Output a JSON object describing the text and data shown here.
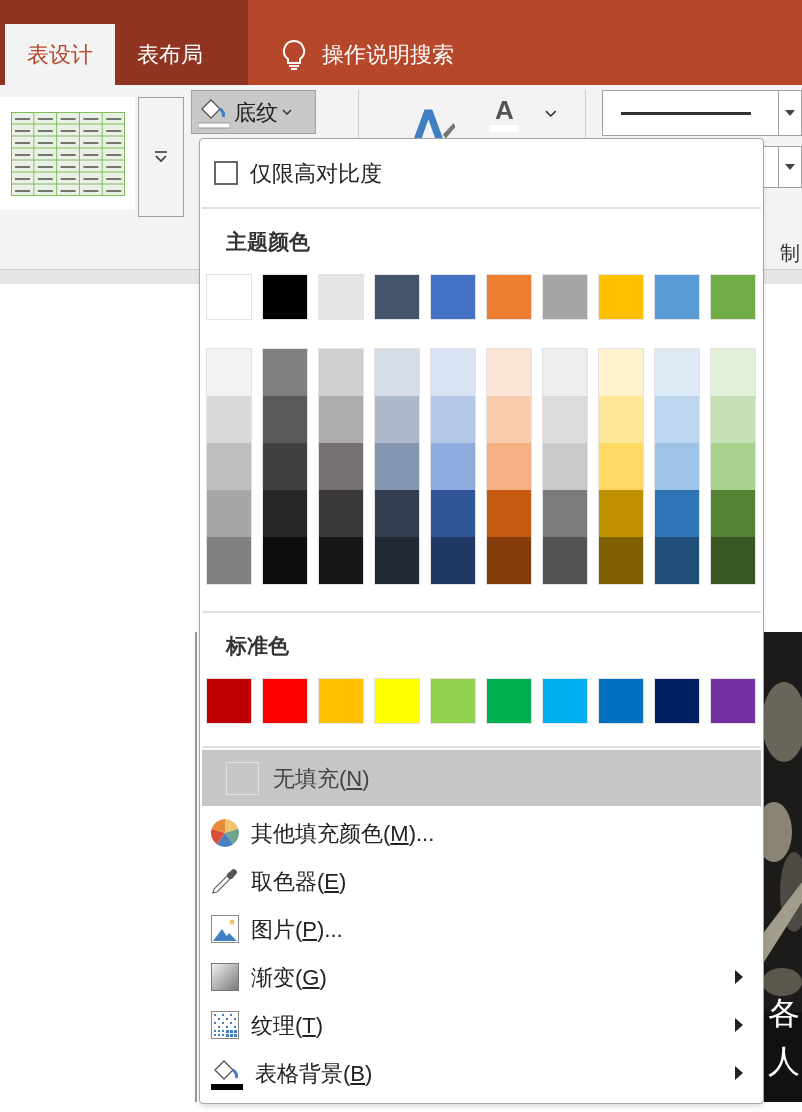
{
  "ribbon_tabs": [
    {
      "label": "表设计",
      "selected": true
    },
    {
      "label": "表布局",
      "selected": false
    }
  ],
  "tell_me": {
    "placeholder": "操作说明搜索"
  },
  "ribbon": {
    "shading_button": {
      "label": "底纹",
      "pressed": true
    },
    "font_color_glyph": "A",
    "group_label": "制"
  },
  "shading_menu": {
    "high_contrast": {
      "label": "仅限高对比度",
      "checked": false
    },
    "theme_heading": "主题颜色",
    "theme_colors": [
      {
        "color": "#ffffff"
      },
      {
        "color": "#000000"
      },
      {
        "color": "#e7e6e6"
      },
      {
        "color": "#44546a"
      },
      {
        "color": "#4472c4"
      },
      {
        "color": "#ed7d31"
      },
      {
        "color": "#a5a5a5"
      },
      {
        "color": "#ffc000"
      },
      {
        "color": "#5b9bd5"
      },
      {
        "color": "#70ad47"
      }
    ],
    "shade_columns": [
      {
        "shades": [
          {
            "color": "#f2f2f2"
          },
          {
            "color": "#d9d9d9"
          },
          {
            "color": "#bfbfbf"
          },
          {
            "color": "#a6a6a6"
          },
          {
            "color": "#808080"
          }
        ]
      },
      {
        "shades": [
          {
            "color": "#7f7f7f"
          },
          {
            "color": "#595959"
          },
          {
            "color": "#404040"
          },
          {
            "color": "#262626"
          },
          {
            "color": "#0d0d0d"
          }
        ]
      },
      {
        "shades": [
          {
            "color": "#d0cece"
          },
          {
            "color": "#aeabab"
          },
          {
            "color": "#767171"
          },
          {
            "color": "#3b3838"
          },
          {
            "color": "#171616"
          }
        ]
      },
      {
        "shades": [
          {
            "color": "#d6dce5"
          },
          {
            "color": "#adb9ca"
          },
          {
            "color": "#8497b0"
          },
          {
            "color": "#333f50"
          },
          {
            "color": "#222a35"
          }
        ]
      },
      {
        "shades": [
          {
            "color": "#dae3f3"
          },
          {
            "color": "#b4c7e7"
          },
          {
            "color": "#8faadc"
          },
          {
            "color": "#2f5597"
          },
          {
            "color": "#203864"
          }
        ]
      },
      {
        "shades": [
          {
            "color": "#fbe5d6"
          },
          {
            "color": "#f8cbad"
          },
          {
            "color": "#f4b183"
          },
          {
            "color": "#c55a11"
          },
          {
            "color": "#843c0c"
          }
        ]
      },
      {
        "shades": [
          {
            "color": "#ededed"
          },
          {
            "color": "#dbdbdb"
          },
          {
            "color": "#c9c9c9"
          },
          {
            "color": "#7b7b7b"
          },
          {
            "color": "#525252"
          }
        ]
      },
      {
        "shades": [
          {
            "color": "#fff2cc"
          },
          {
            "color": "#ffe699"
          },
          {
            "color": "#ffd966"
          },
          {
            "color": "#bf9000"
          },
          {
            "color": "#7f6000"
          }
        ]
      },
      {
        "shades": [
          {
            "color": "#deebf7"
          },
          {
            "color": "#bdd7ee"
          },
          {
            "color": "#9dc3e6"
          },
          {
            "color": "#2e75b6"
          },
          {
            "color": "#1f4e79"
          }
        ]
      },
      {
        "shades": [
          {
            "color": "#e2f0d9"
          },
          {
            "color": "#c5e0b4"
          },
          {
            "color": "#a9d18e"
          },
          {
            "color": "#548235"
          },
          {
            "color": "#385723"
          }
        ]
      }
    ],
    "standard_heading": "标准色",
    "standard_colors": [
      {
        "color": "#c00000"
      },
      {
        "color": "#ff0000"
      },
      {
        "color": "#ffc000"
      },
      {
        "color": "#ffff00"
      },
      {
        "color": "#92d050"
      },
      {
        "color": "#00b050"
      },
      {
        "color": "#00b0f0"
      },
      {
        "color": "#0070c0"
      },
      {
        "color": "#002060"
      },
      {
        "color": "#7030a0"
      }
    ],
    "items": [
      {
        "kind": "no_fill",
        "before": "无填充(",
        "key": "N",
        "after": ")",
        "selected": true,
        "submenu": false
      },
      {
        "kind": "more_colors",
        "before": "其他填充颜色(",
        "key": "M",
        "after": ")...",
        "selected": false,
        "submenu": false
      },
      {
        "kind": "eyedropper",
        "before": "取色器(",
        "key": "E",
        "after": ")",
        "selected": false,
        "submenu": false
      },
      {
        "kind": "picture",
        "before": "图片(",
        "key": "P",
        "after": ")...",
        "selected": false,
        "submenu": false
      },
      {
        "kind": "gradient",
        "before": "渐变(",
        "key": "G",
        "after": ")",
        "selected": false,
        "submenu": true
      },
      {
        "kind": "texture",
        "before": "纹理(",
        "key": "T",
        "after": ")",
        "selected": false,
        "submenu": true
      },
      {
        "kind": "table_background",
        "before": "表格背景(",
        "key": "B",
        "after": ")",
        "selected": false,
        "submenu": true
      }
    ]
  },
  "slide_texts": [
    "各",
    "人"
  ]
}
